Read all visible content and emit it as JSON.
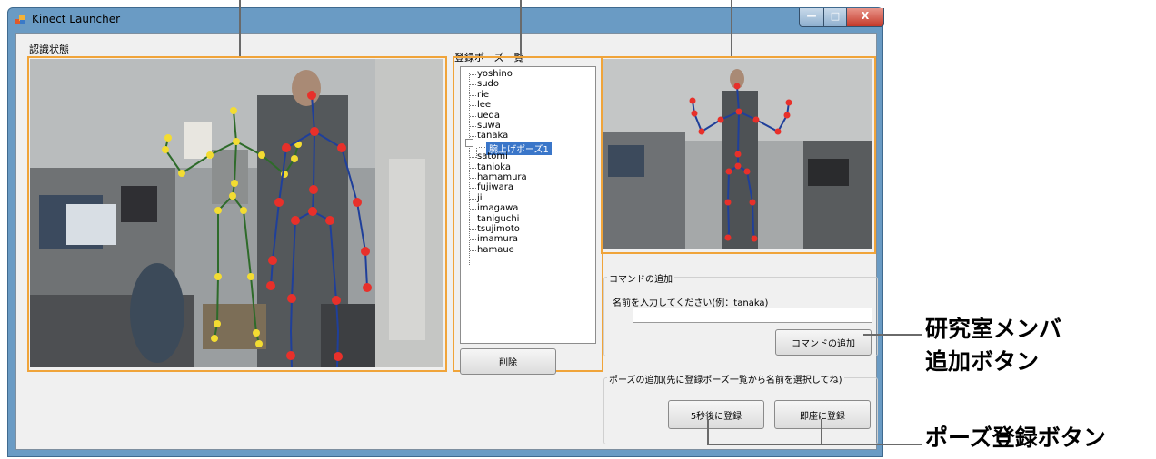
{
  "window": {
    "title": "Kinect Launcher",
    "minimize_glyph": "—",
    "maximize_glyph": "□",
    "close_glyph": "X"
  },
  "recognition_panel": {
    "label": "認識状態"
  },
  "pose_list": {
    "label": "登録ポーズ一覧",
    "items": [
      "yoshino",
      "sudo",
      "rie",
      "lee",
      "ueda",
      "suwa",
      "tanaka"
    ],
    "child": "腕上げポーズ1",
    "items_after": [
      "satomi",
      "tanioka",
      "hamamura",
      "fujiwara",
      "ji",
      "imagawa",
      "taniguchi",
      "tsujimoto",
      "imamura",
      "hamaue"
    ],
    "delete_label": "削除"
  },
  "command_group": {
    "title": "コマンドの追加",
    "prompt": "名前を入力してください(例：tanaka)",
    "input_value": "",
    "add_button": "コマンドの追加"
  },
  "pose_group": {
    "title": "ポーズの追加(先に登録ポーズ一覧から名前を選択してね)",
    "delay_button": "5秒後に登録",
    "now_button": "即座に登録"
  },
  "annotations": {
    "member_add_line1": "研究室メンバ",
    "member_add_line2": "追加ボタン",
    "pose_register": "ポーズ登録ボタン"
  },
  "colors": {
    "highlight": "#f0a43a",
    "selection": "#3a76c9",
    "joint_red": "#e8302a",
    "joint_yellow": "#f3dc32",
    "bone_blue": "#1f3f9a",
    "bone_green": "#2e6b2a"
  }
}
